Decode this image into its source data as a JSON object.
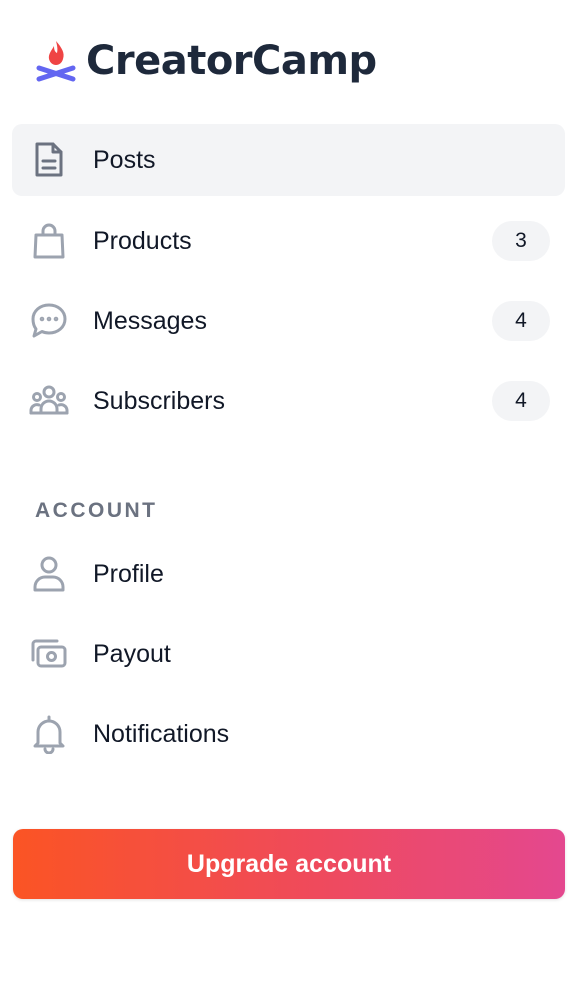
{
  "brand": {
    "name": "CreatorCamp",
    "colors": {
      "flame": "#ef4444",
      "logs": "#6366f1",
      "text": "#1e293b"
    }
  },
  "nav": {
    "items": [
      {
        "label": "Posts",
        "icon": "document-icon",
        "count": null,
        "active": true
      },
      {
        "label": "Products",
        "icon": "shopping-bag-icon",
        "count": "3",
        "active": false
      },
      {
        "label": "Messages",
        "icon": "chat-bubble-icon",
        "count": "4",
        "active": false
      },
      {
        "label": "Subscribers",
        "icon": "user-group-icon",
        "count": "4",
        "active": false
      }
    ]
  },
  "account": {
    "heading": "ACCOUNT",
    "items": [
      {
        "label": "Profile",
        "icon": "user-icon"
      },
      {
        "label": "Payout",
        "icon": "cash-icon"
      },
      {
        "label": "Notifications",
        "icon": "bell-icon"
      }
    ]
  },
  "cta": {
    "label": "Upgrade account",
    "gradient": [
      "#fb5424",
      "#e4488f"
    ]
  },
  "colors": {
    "icon": "#9ca3af",
    "active_icon": "#6b7280",
    "active_bg": "#f3f4f6",
    "heading": "#6b7280"
  }
}
